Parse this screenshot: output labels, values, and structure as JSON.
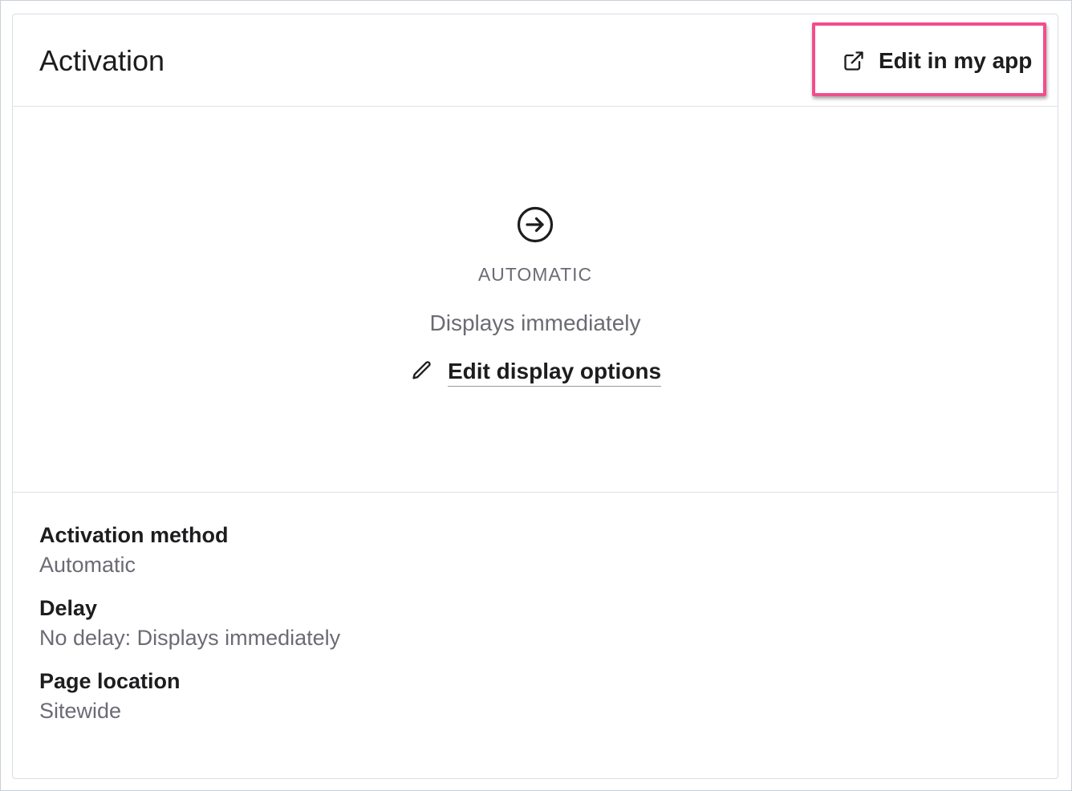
{
  "card": {
    "title": "Activation",
    "edit_app_label": "Edit in my app"
  },
  "status": {
    "icon": "arrow-right-circle-icon",
    "label": "AUTOMATIC",
    "description": "Displays immediately",
    "edit_display_label": "Edit display options",
    "edit_display_icon": "pencil-icon"
  },
  "details": [
    {
      "label": "Activation method",
      "value": "Automatic"
    },
    {
      "label": "Delay",
      "value": "No delay: Displays immediately"
    },
    {
      "label": "Page location",
      "value": "Sitewide"
    }
  ],
  "colors": {
    "highlight": "#f24e8c",
    "text_primary": "#1d1d1f",
    "text_secondary": "#6b6b74"
  }
}
